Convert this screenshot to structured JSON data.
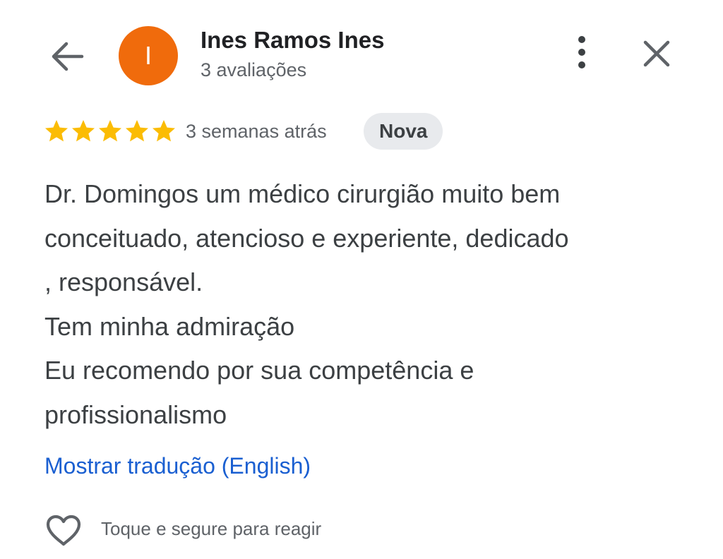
{
  "header": {
    "back_icon": "arrow-left-icon",
    "avatar_letter": "I",
    "avatar_color": "#f06b0c",
    "reviewer_name": "Ines Ramos Ines",
    "review_count": "3 avaliações",
    "more_icon": "more-vert-icon",
    "close_icon": "close-icon"
  },
  "review": {
    "rating": 5,
    "max_rating": 5,
    "star_color": "#fbbc04",
    "time_ago": "3 semanas atrás",
    "badge": "Nova",
    "lines": [
      "Dr. Domingos um médico cirurgião muito bem",
      "conceituado, atencioso e experiente, dedicado",
      ", responsável.",
      "Tem minha admiração",
      "Eu recomendo por sua competência e",
      "profissionalismo"
    ],
    "translate_link": "Mostrar tradução (English)",
    "link_color": "#1a5fd1"
  },
  "reaction": {
    "heart_icon": "heart-outline-icon",
    "hint": "Toque e segure para reagir"
  }
}
